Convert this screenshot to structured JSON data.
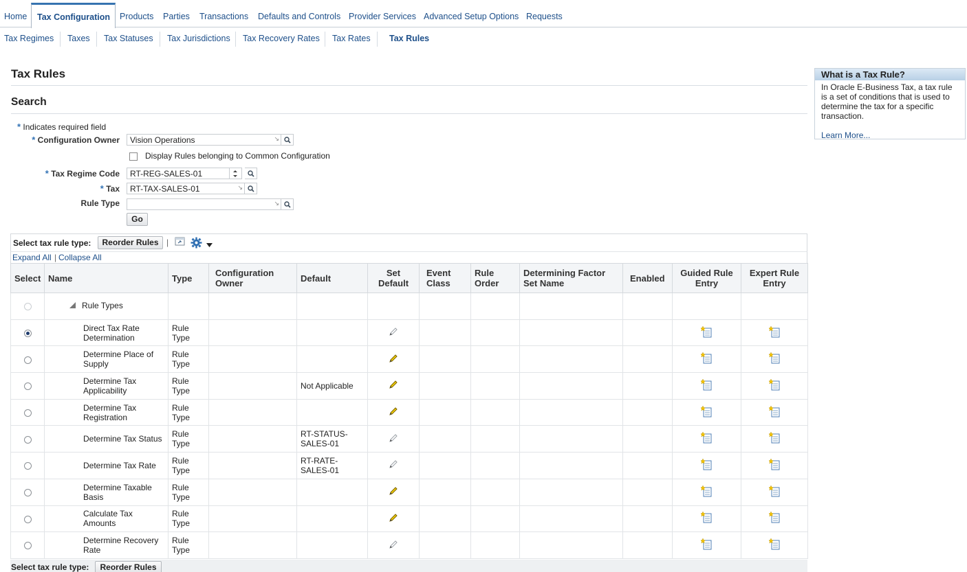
{
  "top_tabs": [
    "Home",
    "Tax Configuration",
    "Products",
    "Parties",
    "Transactions",
    "Defaults and Controls",
    "Provider Services",
    "Advanced Setup Options",
    "Requests"
  ],
  "sub_tabs": [
    "Tax Regimes",
    "Taxes",
    "Tax Statuses",
    "Tax Jurisdictions",
    "Tax Recovery Rates",
    "Tax Rates",
    "Tax Rules"
  ],
  "page_title": "Tax Rules",
  "search": {
    "title": "Search",
    "required_note": "Indicates required field",
    "config_owner_label": "Configuration Owner",
    "config_owner_value": "Vision Operations",
    "common_config_label": "Display Rules belonging to Common Configuration",
    "regime_label": "Tax Regime Code",
    "regime_value": "RT-REG-SALES-01",
    "tax_label": "Tax",
    "tax_value": "RT-TAX-SALES-01",
    "rule_type_label": "Rule Type",
    "rule_type_value": "",
    "go_label": "Go"
  },
  "toolbar": {
    "select_label": "Select tax rule type:",
    "reorder_label": "Reorder Rules",
    "expand_all": "Expand All",
    "collapse_all": "Collapse All"
  },
  "table": {
    "headers": [
      "Select",
      "Name",
      "Type",
      "Configuration Owner",
      "Default",
      "Set Default",
      "Event Class",
      "Rule Order",
      "Determining Factor Set Name",
      "Enabled",
      "Guided Rule Entry",
      "Expert Rule Entry"
    ],
    "root_label": "Rule Types",
    "rows": [
      {
        "name": "Direct Tax Rate Determination",
        "type": "Rule Type",
        "default": "",
        "selected": true,
        "pencil_active": false
      },
      {
        "name": "Determine Place of Supply",
        "type": "Rule Type",
        "default": "",
        "selected": false,
        "pencil_active": true
      },
      {
        "name": "Determine Tax Applicability",
        "type": "Rule Type",
        "default": "Not Applicable",
        "selected": false,
        "pencil_active": true
      },
      {
        "name": "Determine Tax Registration",
        "type": "Rule Type",
        "default": "",
        "selected": false,
        "pencil_active": true
      },
      {
        "name": "Determine Tax Status",
        "type": "Rule Type",
        "default": "RT-STATUS-SALES-01",
        "selected": false,
        "pencil_active": false
      },
      {
        "name": "Determine Tax Rate",
        "type": "Rule Type",
        "default": "RT-RATE-SALES-01",
        "selected": false,
        "pencil_active": false
      },
      {
        "name": "Determine Taxable Basis",
        "type": "Rule Type",
        "default": "",
        "selected": false,
        "pencil_active": true
      },
      {
        "name": "Calculate Tax Amounts",
        "type": "Rule Type",
        "default": "",
        "selected": false,
        "pencil_active": true
      },
      {
        "name": "Determine Recovery Rate",
        "type": "Rule Type",
        "default": "",
        "selected": false,
        "pencil_active": false
      }
    ]
  },
  "bottom": {
    "select_label": "Select tax rule type:",
    "reorder_label": "Reorder Rules"
  },
  "side_box": {
    "title": "What is a Tax Rule?",
    "body": "In Oracle E-Business Tax, a tax rule is a set of conditions that is used to determine the tax for a specific transaction.",
    "link": "Learn More..."
  },
  "colors": {
    "link": "#1d4f8a",
    "accent": "#3673b0",
    "pencil_active": "#e8c400"
  },
  "icons": {
    "search": "search-icon",
    "set_default": "pencil-icon",
    "guided": "new-document-icon",
    "expert": "new-document-icon",
    "settings": "gear-icon",
    "tree_toggle": "triangle-collapse-icon",
    "detach": "detach-icon"
  }
}
